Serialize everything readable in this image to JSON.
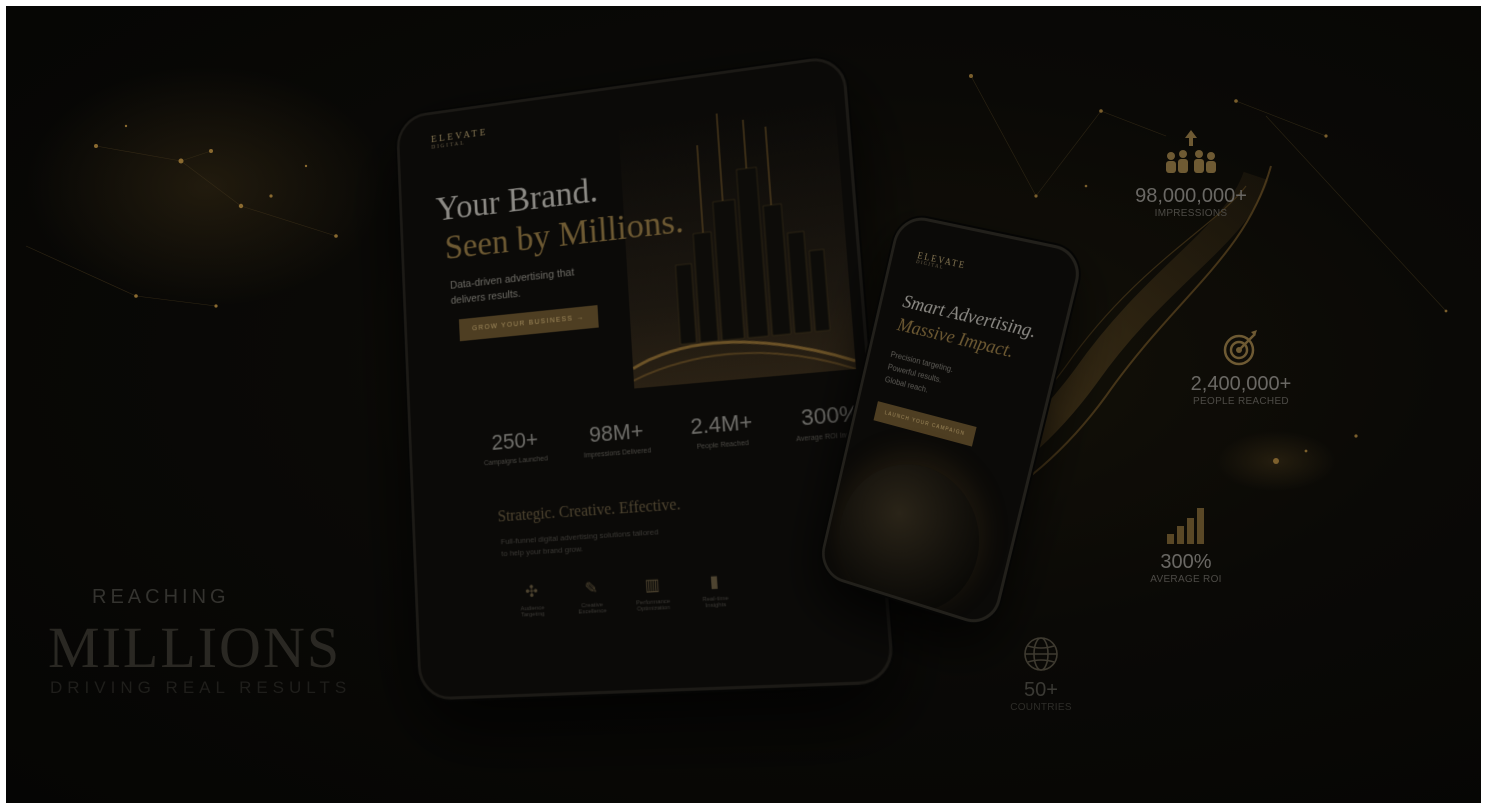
{
  "tablet": {
    "logo": "ELEVATE",
    "logo_sub": "DIGITAL",
    "headline_1": "Your Brand.",
    "headline_2": "Seen by Millions.",
    "subtitle": "Data-driven advertising that delivers results.",
    "cta": "GROW YOUR BUSINESS →",
    "stats": [
      {
        "value": "250+",
        "label": "Campaigns Launched"
      },
      {
        "value": "98M+",
        "label": "Impressions Delivered"
      },
      {
        "value": "2.4M+",
        "label": "People Reached"
      },
      {
        "value": "300%",
        "label": "Average ROI Increase"
      }
    ],
    "section_title": "Strategic. Creative. Effective.",
    "section_sub": "Full-funnel digital advertising solutions tailored to help your brand grow.",
    "features": [
      {
        "icon": "audience-icon",
        "glyph": "✣",
        "label": "Audience Targeting"
      },
      {
        "icon": "creative-icon",
        "glyph": "✎",
        "label": "Creative Excellence"
      },
      {
        "icon": "performance-icon",
        "glyph": "▥",
        "label": "Performance Optimization"
      },
      {
        "icon": "insights-icon",
        "glyph": "▮",
        "label": "Real-time Insights"
      }
    ]
  },
  "phone": {
    "logo": "ELEVATE",
    "logo_sub": "DIGITAL",
    "headline_1": "Smart Advertising.",
    "headline_2": "Massive Impact.",
    "lines": [
      "Precision targeting.",
      "Powerful results.",
      "Global reach."
    ],
    "cta": "LAUNCH YOUR CAMPAIGN"
  },
  "right_stats": [
    {
      "icon": "people-growth-icon",
      "value": "98,000,000+",
      "label": "IMPRESSIONS"
    },
    {
      "icon": "target-icon",
      "value": "2,400,000+",
      "label": "PEOPLE REACHED"
    },
    {
      "icon": "bar-chart-icon",
      "value": "300%",
      "label": "AVERAGE ROI"
    },
    {
      "icon": "globe-icon",
      "value": "50+",
      "label": "COUNTRIES"
    }
  ],
  "left_text": {
    "reaching": "REACHING",
    "millions": "MILLIONS",
    "driving": "DRIVING REAL RESULTS"
  },
  "colors": {
    "gold": "#6e5a33",
    "background": "#0a0906"
  }
}
